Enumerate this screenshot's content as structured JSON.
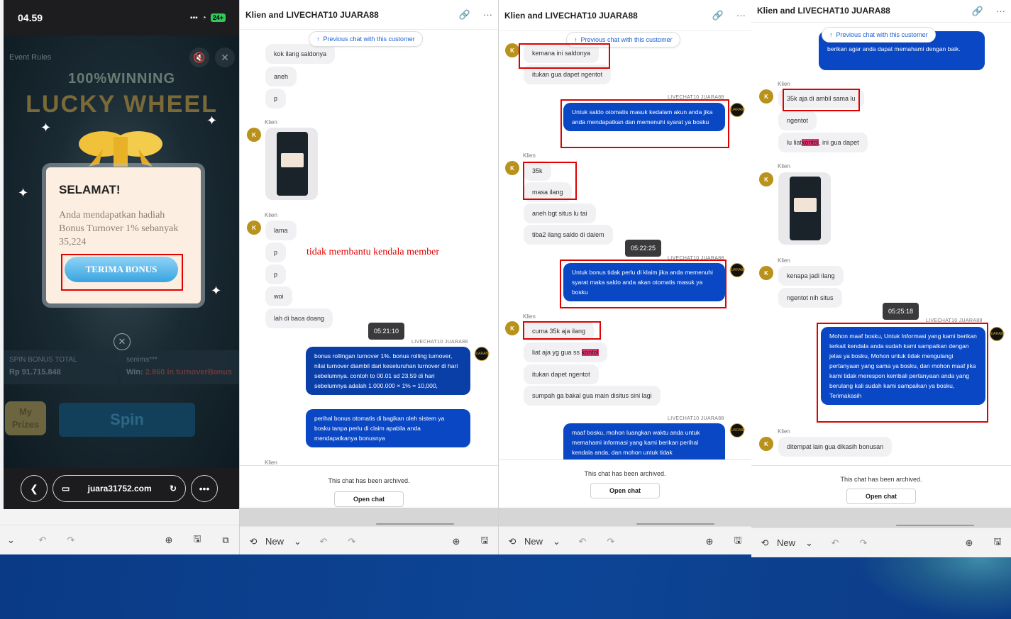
{
  "phone": {
    "time": "04.59",
    "battery": "24+",
    "event_rules": "Event Rules",
    "winning": "100%WINNING",
    "lucky_wheel": "LUCKY WHEEL",
    "modal_title": "SELAMAT!",
    "modal_text": "Anda mendapatkan hadiah Bonus Turnover 1% sebanyak 35,224",
    "terima_button": "TERIMA BONUS",
    "stat_left_label": "SPIN BONUS TOTAL",
    "stat_left_value": "Rp 91.715.848",
    "stat_right_label": "senima***",
    "stat_right_value_prefix": "Win:",
    "stat_right_value": "2.860 in turnoverBonus",
    "my_prizes": "My Prizes",
    "spin": "Spin",
    "url": "juara31752.com"
  },
  "toolbar": {
    "new_label": "New"
  },
  "chat_common": {
    "title": "Klien and LIVECHAT10 JUARA88",
    "prev_chat": "Previous chat with this customer",
    "klien": "Klien",
    "agent": "LIVECHAT10 JUARA88",
    "avatar_letter": "K",
    "agent_avatar_text": "JUARA88",
    "archived": "This chat has been archived.",
    "open_chat": "Open chat"
  },
  "annotation": "tidak membantu kendala member",
  "chat1": {
    "m1": "kok ilang saldonya",
    "m2": "aneh",
    "m3": "p",
    "m4": "lama",
    "m5": "p",
    "m6": "p",
    "m7": "woi",
    "m8": "lah di baca doang",
    "time": "05:21:10",
    "a1": "bonus rollingan turnover 1%. bonus rolling turnover, nilai turnover diambil dari keseluruhan turnover di hari sebelumnya. contoh to 00.01 sd 23.59 di hari sebelumnya adalah 1.000.000 × 1% = 10,000,",
    "a2": "perihal bonus otomatis di bagikan oleh sistem ya bosku tanpa perlu di claim apabila anda mendapatkanya bonusnya"
  },
  "chat2": {
    "m1": "kemana ini saldonya",
    "m2": "itukan gua dapet ngentot",
    "a1": "Untuk saldo otomatis masuk kedalam akun anda jika anda mendapatkan dan memenuhi syarat ya bosku",
    "m3": "35k",
    "m4": "masa ilang",
    "m5": "aneh bgt situs lu tai",
    "m6": "tiba2 ilang saldo di dalem",
    "time": "05:22:25",
    "a2": "Untuk bonus tidak perlu di klaim jika anda memenuhi syarat maka saldo anda akan otomatis masuk ya bosku",
    "m7": "cuma 35k aja ilang",
    "m8_pre": "liat aja yg gua ss ",
    "m8_hl": "kontol",
    "m9": "itukan dapet ngentot",
    "m10": "sumpah ga bakal gua main disitus sini lagi",
    "a3": "maaf bosku, mohon luangkan waktu anda untuk memahami informasi yang kami berikan perihal kendala anda, dan mohon untuk tidak"
  },
  "chat3": {
    "a0": "berikan agar anda dapat memahami dengan baik.",
    "m1": "35k aja di ambil sama lu",
    "m2": "ngentot",
    "m3_pre": "lu liat ",
    "m3_hl": "kontol",
    "m3_post": ", ini gua dapet",
    "m4": "kenapa jadi ilang",
    "m5": "ngentot nih situs",
    "time": "05:25:18",
    "a1": "Mohon maaf bosku, Untuk Informasi yang kami berikan terkait kendala anda sudah kami sampaikan dengan jelas ya bosku, Mohon untuk tidak mengulangi pertanyaan yang sama ya bosku, dan mohon maaf jika kami tidak merespon kembali pertanyaan anda yang berulang kali sudah kami sampaikan ya bosku, Terimakasih",
    "m6": "ditempat lain gua dikasih bonusan"
  }
}
